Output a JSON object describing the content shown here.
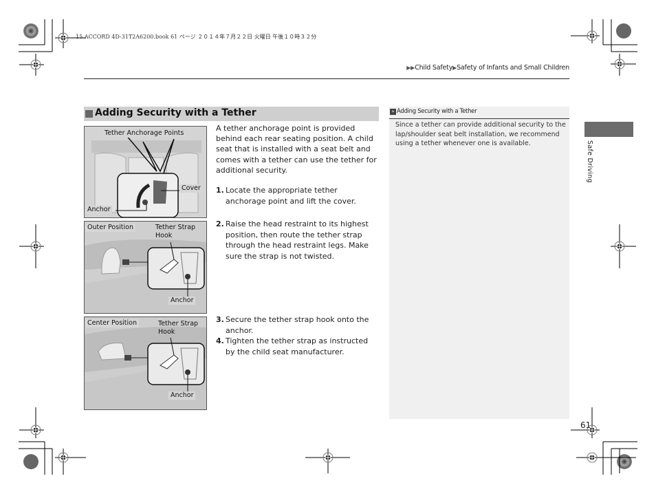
{
  "print_header": "15 ACCORD 4D-31T2A6200.book  61 ページ  ２０１４年７月２２日  火曜日  午後１０時３２分",
  "breadcrumb": {
    "arrows": "▶▶",
    "items": [
      "Child Safety",
      "Safety of Infants and Small Children"
    ],
    "separator": "▶"
  },
  "section": {
    "title": "Adding Security with a Tether",
    "intro": "A tether anchorage point is provided behind each rear seating position. A child seat that is installed with a seat belt and comes with a tether can use the tether for additional security.",
    "steps": [
      {
        "num": "1.",
        "text": "Locate the appropriate tether anchorage point and lift the cover."
      },
      {
        "num": "2.",
        "text": "Raise the head restraint to its highest position, then route the tether strap through the head restraint legs. Make sure the strap is not twisted."
      },
      {
        "num": "3.",
        "text": "Secure the tether strap hook onto the anchor."
      },
      {
        "num": "4.",
        "text": "Tighten the tether strap as instructed by the child seat manufacturer."
      }
    ]
  },
  "figures": [
    {
      "labels": {
        "top": "Tether Anchorage Points",
        "cover": "Cover",
        "anchor": "Anchor"
      }
    },
    {
      "labels": {
        "position": "Outer Position",
        "hook": "Tether Strap\nHook",
        "hook_line1": "Tether Strap",
        "hook_line2": "Hook",
        "anchor": "Anchor"
      }
    },
    {
      "labels": {
        "position": "Center Position",
        "hook_line1": "Tether Strap",
        "hook_line2": "Hook",
        "anchor": "Anchor"
      }
    }
  ],
  "side_note": {
    "icon": "»",
    "title": "Adding Security with a Tether",
    "text": "Since a tether can provide additional security to the lap/shoulder seat belt installation, we recommend using a tether whenever one is available."
  },
  "chapter_tab": "Safe Driving",
  "page_number": "61"
}
